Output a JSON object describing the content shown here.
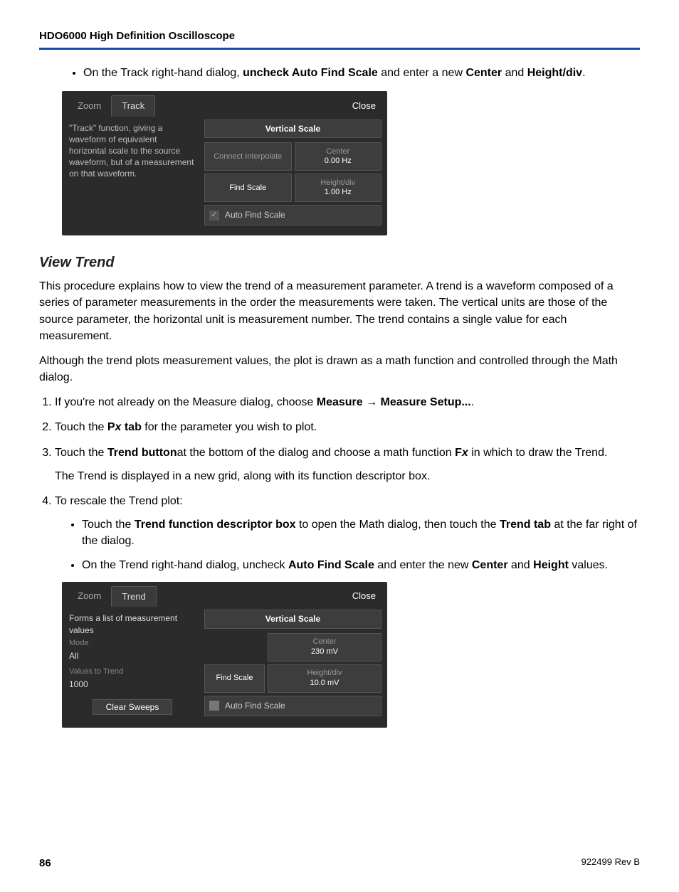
{
  "header": {
    "title": "HDO6000 High Definition Oscilloscope"
  },
  "intro_bullet": {
    "pre": "On the Track right-hand dialog, ",
    "b1": "uncheck Auto Find Scale",
    "mid": " and enter a new ",
    "b2": "Center",
    "mid2": " and ",
    "b3": "Height/div",
    "post": "."
  },
  "dialog1": {
    "tabs": {
      "zoom": "Zoom",
      "track": "Track"
    },
    "close": "Close",
    "left_text": "\"Track\" function, giving a waveform of equivalent horizontal scale to the source waveform, but of a measurement on that waveform.",
    "vs_header": "Vertical Scale",
    "connect": "Connect Interpolate",
    "center_lbl": "Center",
    "center_val": "0.00 Hz",
    "find_lbl": "Find Scale",
    "height_lbl": "Height/div",
    "height_val": "1.00 Hz",
    "auto": "Auto Find Scale",
    "check_glyph": "✓"
  },
  "section": {
    "title": "View Trend",
    "p1": "This procedure explains how to view the trend of a measurement parameter. A trend is a waveform composed of a series of parameter measurements in the order the measurements were taken. The vertical units are those of the source parameter, the horizontal unit is measurement number. The trend contains a single value for each measurement.",
    "p2": "Although the trend plots measurement values, the plot is drawn as a math function and controlled through the Math dialog."
  },
  "steps": {
    "s1_pre": "If you're not already on the Measure dialog, choose ",
    "s1_b1": "Measure",
    "s1_arrow": " → ",
    "s1_b2": "Measure Setup...",
    "s1_post": ".",
    "s2_pre": "Touch the ",
    "s2_b1a": "P",
    "s2_b1b": "x",
    "s2_b1c": " tab",
    "s2_post": "  for the parameter you wish to plot.",
    "s3_pre": "Touch the ",
    "s3_b1": "Trend button",
    "s3_mid": "at the bottom of the dialog and choose a math function ",
    "s3_b2a": "F",
    "s3_b2b": "x",
    "s3_post": " in which to draw the Trend.",
    "s3_sub": "The Trend is displayed in a new grid, along with its function descriptor box.",
    "s4": "To rescale the Trend plot:",
    "s4b1_pre": "Touch the ",
    "s4b1_b1": "Trend function descriptor box",
    "s4b1_mid": " to open the Math dialog, then touch the ",
    "s4b1_b2": "Trend tab",
    "s4b1_post": " at the far right of the dialog.",
    "s4b2_pre": "On the Trend right-hand dialog, uncheck ",
    "s4b2_b1": "Auto Find Scale",
    "s4b2_mid": " and enter the new ",
    "s4b2_b2": "Center",
    "s4b2_mid2": " and ",
    "s4b2_b3": "Height",
    "s4b2_post": " values."
  },
  "dialog2": {
    "tabs": {
      "zoom": "Zoom",
      "trend": "Trend"
    },
    "close": "Close",
    "left_text": "Forms a list of measurement values",
    "mode_lbl": "Mode",
    "mode_val": "All",
    "vtt_lbl": "Values to Trend",
    "vtt_val": "1000",
    "clear": "Clear Sweeps",
    "vs_header": "Vertical Scale",
    "find_lbl": "Find Scale",
    "center_lbl": "Center",
    "center_val": "230 mV",
    "height_lbl": "Height/div",
    "height_val": "10.0 mV",
    "auto": "Auto Find Scale"
  },
  "footer": {
    "page": "86",
    "rev": "922499 Rev B"
  }
}
